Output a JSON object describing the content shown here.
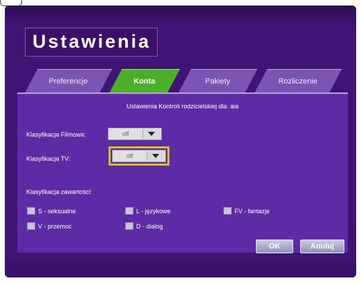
{
  "window": {
    "title": "Ustawienia"
  },
  "tabs": [
    {
      "label": "Preferencje",
      "active": false
    },
    {
      "label": "Konta",
      "active": true
    },
    {
      "label": "Pakiety",
      "active": false
    },
    {
      "label": "Rozliczenie",
      "active": false
    }
  ],
  "panel": {
    "heading": "Ustawienia Kontroli rodzicielskiej dla: aia",
    "movie_rating": {
      "label": "Klasyfikacja Filmowa:",
      "value": "off"
    },
    "tv_rating": {
      "label": "Klasyfikacja TV:",
      "value": "off"
    },
    "content_section_label": "Klasyfikacja zawartości:",
    "content_options": [
      {
        "label": "S - seksualne"
      },
      {
        "label": "L - językowe"
      },
      {
        "label": "FV - fantazje"
      },
      {
        "label": "V - przemoc"
      },
      {
        "label": "D - dialog"
      }
    ]
  },
  "buttons": {
    "ok": "OK",
    "cancel": "Anuluj"
  },
  "colors": {
    "background": "#3f1474",
    "panel": "#5e2ba6",
    "tab_inactive": "#7b55b3",
    "tab_active": "#4caf29",
    "focus_outline": "#d8c21c"
  }
}
